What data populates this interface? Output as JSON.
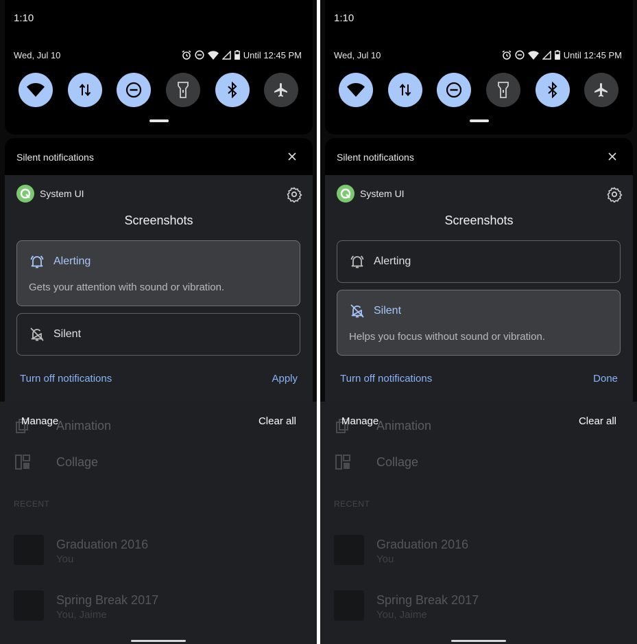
{
  "colors": {
    "tile_on": "#a8c8fa",
    "tile_off": "#3a3b3d",
    "accent_link": "#8ab4f8",
    "panel_bg": "#202124",
    "app_logo": "#7bc96f"
  },
  "screens": [
    {
      "status_time": "1:10",
      "date": "Wed, Jul 10",
      "until": "Until 12:45 PM",
      "status_icons": [
        "alarm-icon",
        "do-not-disturb-icon",
        "wifi-icon",
        "cell-signal-icon",
        "battery-icon"
      ],
      "tiles": [
        {
          "icon": "wifi-icon",
          "state": "on"
        },
        {
          "icon": "mobile-data-icon",
          "state": "on"
        },
        {
          "icon": "do-not-disturb-icon",
          "state": "on"
        },
        {
          "icon": "flashlight-icon",
          "state": "off"
        },
        {
          "icon": "bluetooth-icon",
          "state": "on"
        },
        {
          "icon": "airplane-mode-icon",
          "state": "off"
        }
      ],
      "panel_title": "Silent notifications",
      "app_name": "System UI",
      "channel": "Screenshots",
      "alerting_label": "Alerting",
      "alerting_desc": "Gets your attention with sound or vibration.",
      "silent_label": "Silent",
      "selected": "alerting",
      "turn_off": "Turn off notifications",
      "confirm": "Apply",
      "manage": "Manage",
      "clear_all": "Clear all",
      "bg_items": [
        "Animation",
        "Collage"
      ],
      "recent": "RECENT",
      "albums": [
        {
          "title": "Graduation 2016",
          "sub": "You"
        },
        {
          "title": "Spring Break 2017",
          "sub": "You, Jaime"
        }
      ]
    },
    {
      "status_time": "1:10",
      "date": "Wed, Jul 10",
      "until": "Until 12:45 PM",
      "status_icons": [
        "alarm-icon",
        "do-not-disturb-icon",
        "wifi-icon",
        "cell-signal-icon",
        "battery-icon"
      ],
      "tiles": [
        {
          "icon": "wifi-icon",
          "state": "on"
        },
        {
          "icon": "mobile-data-icon",
          "state": "on"
        },
        {
          "icon": "do-not-disturb-icon",
          "state": "on"
        },
        {
          "icon": "flashlight-icon",
          "state": "off"
        },
        {
          "icon": "bluetooth-icon",
          "state": "on"
        },
        {
          "icon": "airplane-mode-icon",
          "state": "off"
        }
      ],
      "panel_title": "Silent notifications",
      "app_name": "System UI",
      "channel": "Screenshots",
      "alerting_label": "Alerting",
      "silent_label": "Silent",
      "silent_desc": "Helps you focus without sound or vibration.",
      "selected": "silent",
      "turn_off": "Turn off notifications",
      "confirm": "Done",
      "manage": "Manage",
      "clear_all": "Clear all",
      "bg_items": [
        "Animation",
        "Collage"
      ],
      "recent": "RECENT",
      "albums": [
        {
          "title": "Graduation 2016",
          "sub": "You"
        },
        {
          "title": "Spring Break 2017",
          "sub": "You, Jaime"
        }
      ]
    }
  ]
}
